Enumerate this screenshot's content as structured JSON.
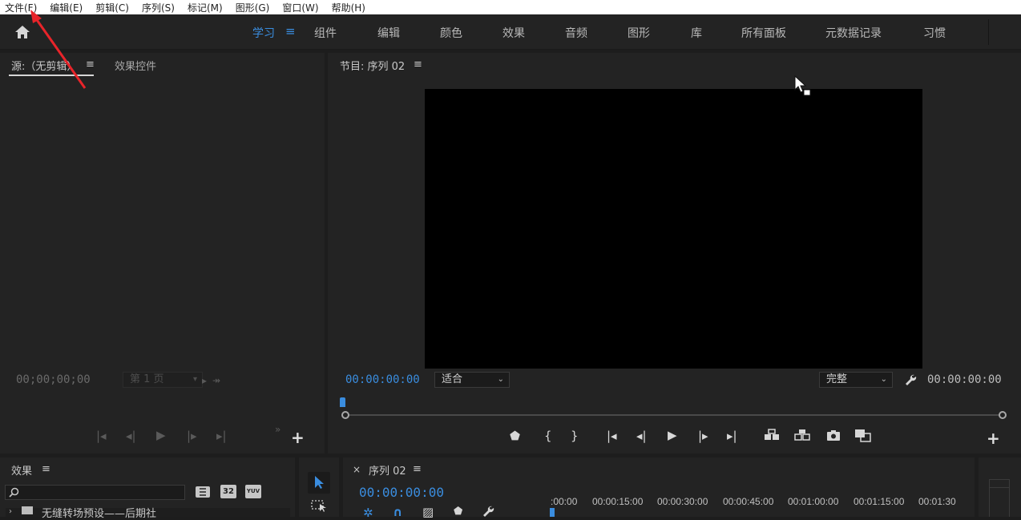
{
  "menu": [
    "文件(F)",
    "编辑(E)",
    "剪辑(C)",
    "序列(S)",
    "标记(M)",
    "图形(G)",
    "窗口(W)",
    "帮助(H)"
  ],
  "workspaces": [
    "学习",
    "组件",
    "编辑",
    "颜色",
    "效果",
    "音频",
    "图形",
    "库",
    "所有面板",
    "元数据记录",
    "习惯"
  ],
  "workspace_menu": "≡",
  "source_panel": {
    "tab_source": "源:（无剪辑）",
    "tab_effect_controls": "效果控件",
    "menu": "≡",
    "timecode": "00;00;00;00",
    "page_select": "第 1 页"
  },
  "program_panel": {
    "title": "节目: 序列 02",
    "menu": "≡",
    "timecode_left": "00:00:00:00",
    "fit_select": "适合",
    "quality_select": "完整",
    "timecode_right": "00:00:00:00"
  },
  "effects_panel": {
    "title": "效果",
    "menu": "≡",
    "badge_32": "32",
    "badge_yuv": "YUV",
    "preset_item": "无缝转场预设——后期社"
  },
  "timeline_panel": {
    "close": "×",
    "title": "序列 02",
    "menu": "≡",
    "timecode": "00:00:00:00",
    "ruler": [
      ":00:00",
      "00:00:15:00",
      "00:00:30:00",
      "00:00:45:00",
      "00:01:00:00",
      "00:01:15:00",
      "00:01:30"
    ]
  },
  "colors": {
    "accent": "#3a8ddf",
    "annotation": "#e8242a"
  }
}
